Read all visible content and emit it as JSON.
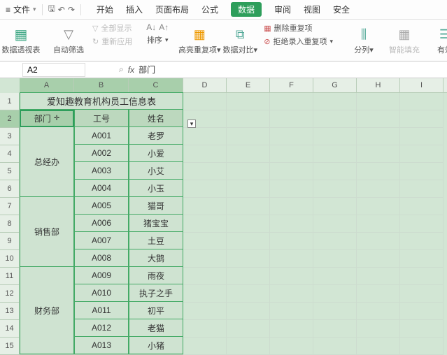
{
  "top": {
    "file": "文件",
    "tabs": [
      "开始",
      "插入",
      "页面布局",
      "公式",
      "数据",
      "审阅",
      "视图",
      "安全"
    ],
    "active_tab": "数据"
  },
  "ribbon": {
    "pivot": "数据透视表",
    "autofilter": "自动筛选",
    "showall": "全部显示",
    "reapply": "重新应用",
    "sort": "排序",
    "highlight": "高亮重复项",
    "compare": "数据对比",
    "delete_dup": "删除重复项",
    "reject_dup": "拒绝录入重复项",
    "columns": "分列",
    "fill": "智能填充",
    "valid": "有效"
  },
  "addr": {
    "ref": "A2",
    "fx_val": "部门"
  },
  "cols": [
    "A",
    "B",
    "C",
    "D",
    "E",
    "F",
    "G",
    "H",
    "I"
  ],
  "rows": [
    "1",
    "2",
    "3",
    "4",
    "5",
    "6",
    "7",
    "8",
    "9",
    "10",
    "11",
    "12",
    "13",
    "14",
    "15"
  ],
  "table": {
    "title": "爱知趣教育机构员工信息表",
    "headers": [
      "部门",
      "工号",
      "姓名"
    ],
    "depts": [
      "总经办",
      "销售部",
      "财务部"
    ],
    "data": [
      [
        "A001",
        "老罗"
      ],
      [
        "A002",
        "小爱"
      ],
      [
        "A003",
        "小艾"
      ],
      [
        "A004",
        "小玉"
      ],
      [
        "A005",
        "猫哥"
      ],
      [
        "A006",
        "猪宝宝"
      ],
      [
        "A007",
        "土豆"
      ],
      [
        "A008",
        "大鹅"
      ],
      [
        "A009",
        "雨夜"
      ],
      [
        "A010",
        "执子之手"
      ],
      [
        "A011",
        "初平"
      ],
      [
        "A012",
        "老猫"
      ],
      [
        "A013",
        "小猪"
      ]
    ]
  }
}
